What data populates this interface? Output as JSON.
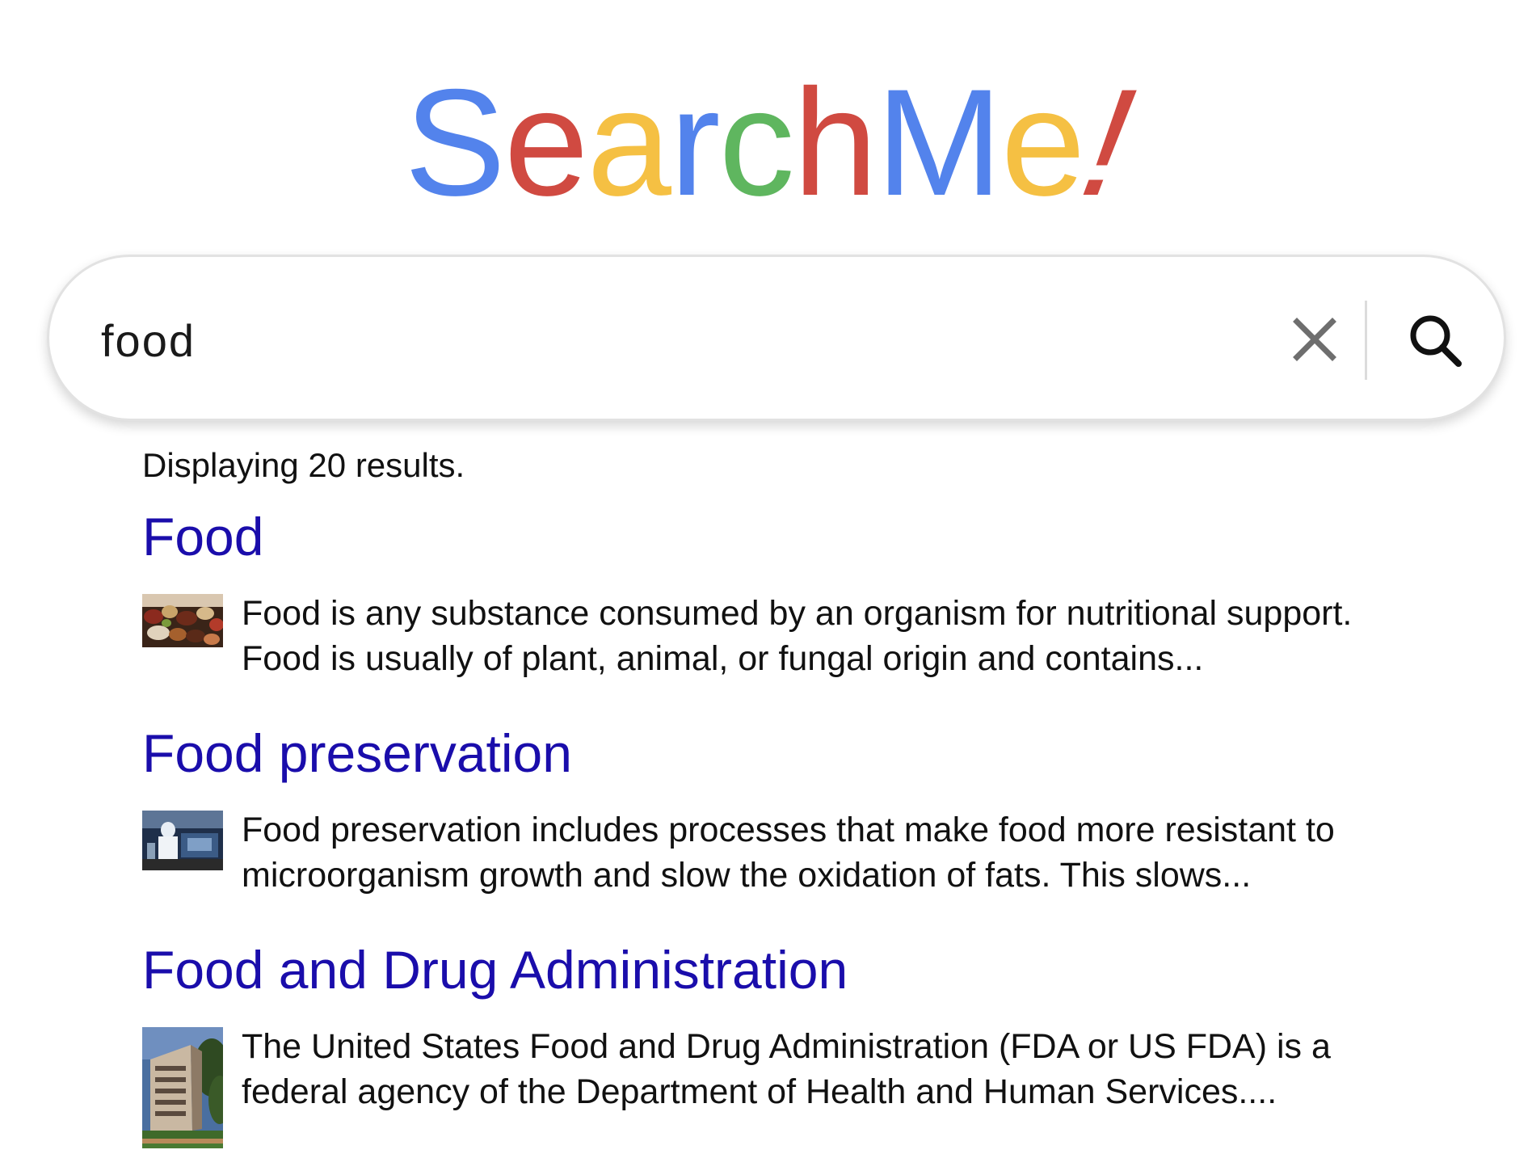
{
  "logo": {
    "letters": [
      {
        "char": "S",
        "color": "#5383ec"
      },
      {
        "char": "e",
        "color": "#d04a41"
      },
      {
        "char": "a",
        "color": "#f5c043"
      },
      {
        "char": "r",
        "color": "#5383ec"
      },
      {
        "char": "c",
        "color": "#5fb65f"
      },
      {
        "char": "h",
        "color": "#d04a41"
      },
      {
        "char": "M",
        "color": "#5383ec"
      },
      {
        "char": "e",
        "color": "#f5c043"
      },
      {
        "char": "!",
        "color": "#d04a41"
      }
    ]
  },
  "search": {
    "value": "food",
    "clear_icon": "close-icon",
    "submit_icon": "search-icon"
  },
  "results": {
    "count_text": "Displaying 20 results.",
    "items": [
      {
        "title": "Food",
        "snippet_line1": "Food is any substance consumed by an organism for nutritional support.",
        "snippet_line2": "Food is usually of plant, animal, or fungal origin and contains...",
        "thumbnail": "food-thumbnail"
      },
      {
        "title": "Food preservation",
        "snippet_line1": "Food preservation includes processes that make food more resistant to",
        "snippet_line2": "microorganism growth and slow the oxidation of fats. This slows...",
        "thumbnail": "food-preservation-thumbnail"
      },
      {
        "title": "Food and Drug Administration",
        "snippet_line1": "The United States Food and Drug Administration (FDA or US FDA) is a",
        "snippet_line2": "federal agency of the Department of Health and Human Services....",
        "thumbnail": "fda-building-thumbnail"
      }
    ]
  },
  "colors": {
    "link": "#1a0dab",
    "text": "#111111",
    "border": "#e2e2e2"
  }
}
